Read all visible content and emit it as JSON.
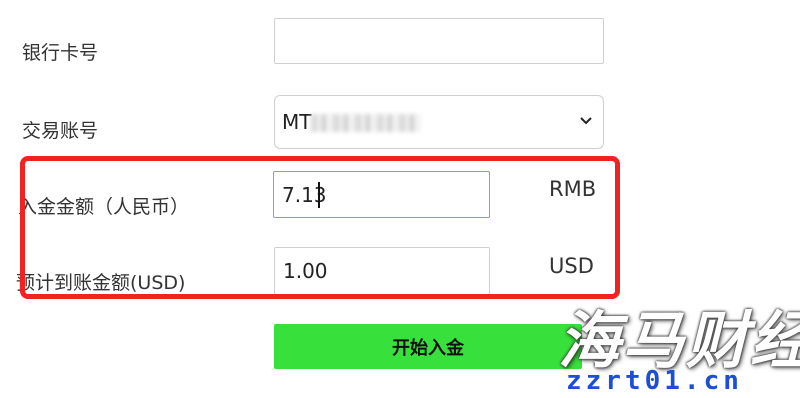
{
  "form": {
    "bank_card_label": "银行卡号",
    "bank_card_value": "",
    "trading_account_label": "交易账号",
    "trading_account_value": "MT",
    "deposit_label": "入金金额（人民币）",
    "deposit_value": "7.13",
    "deposit_unit": "RMB",
    "expected_label": "预计到账金额(USD)",
    "expected_value": "1.00",
    "expected_unit": "USD",
    "submit_label": "开始入金"
  },
  "watermark": {
    "logo_text": "海马财经",
    "url": "zzrt01.cn"
  },
  "colors": {
    "submit_bg": "#37e03b",
    "highlight_border": "#f02323",
    "focused_input_border": "#8cb34a",
    "watermark_url": "#1d4fd6"
  },
  "icons": {
    "select_arrow": "chevron-down-icon"
  }
}
